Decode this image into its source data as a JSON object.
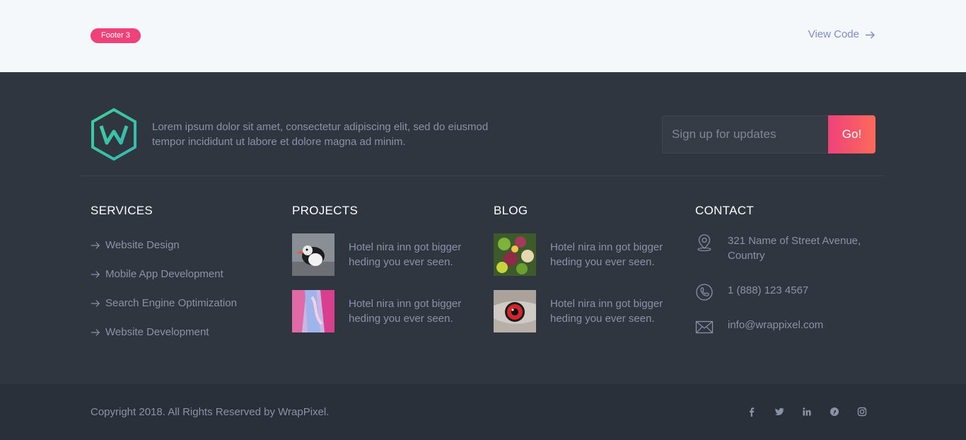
{
  "header": {
    "badge_label": "Footer 3",
    "view_code_label": "View Code"
  },
  "footer": {
    "about_text": "Lorem ipsum dolor sit amet, consectetur adipiscing elit, sed do eiusmod tempor incididunt ut labore et dolore magna ad minim.",
    "signup": {
      "placeholder": "Sign up for updates",
      "button_label": "Go!"
    },
    "services": {
      "title": "SERVICES",
      "items": [
        "Website Design",
        "Mobile App Development",
        "Search Engine Optimization",
        "Website Development"
      ]
    },
    "projects": {
      "title": "PROJECTS",
      "items": [
        {
          "text": "Hotel nira inn got bigger heding you ever seen."
        },
        {
          "text": "Hotel nira inn got bigger heding you ever seen."
        }
      ]
    },
    "blog": {
      "title": "BLOG",
      "items": [
        {
          "text": "Hotel nira inn got bigger heding you ever seen."
        },
        {
          "text": "Hotel nira inn got bigger heding you ever seen."
        }
      ]
    },
    "contact": {
      "title": "CONTACT",
      "address": "321 Name of Street Avenue, Country",
      "phone": "1 (888) 123 4567",
      "email": "info@wrappixel.com"
    }
  },
  "bottom": {
    "copyright": "Copyright 2018. All Rights Reserved by WrapPixel.",
    "social_icons": [
      "facebook-icon",
      "twitter-icon",
      "linkedin-icon",
      "pinterest-icon",
      "instagram-icon"
    ]
  },
  "colors": {
    "accent": "#f0427a",
    "footer_bg": "#2f3640",
    "bottom_bg": "#2a3039",
    "top_bg": "#f4f8fb",
    "logo": "#3ecf9e"
  }
}
